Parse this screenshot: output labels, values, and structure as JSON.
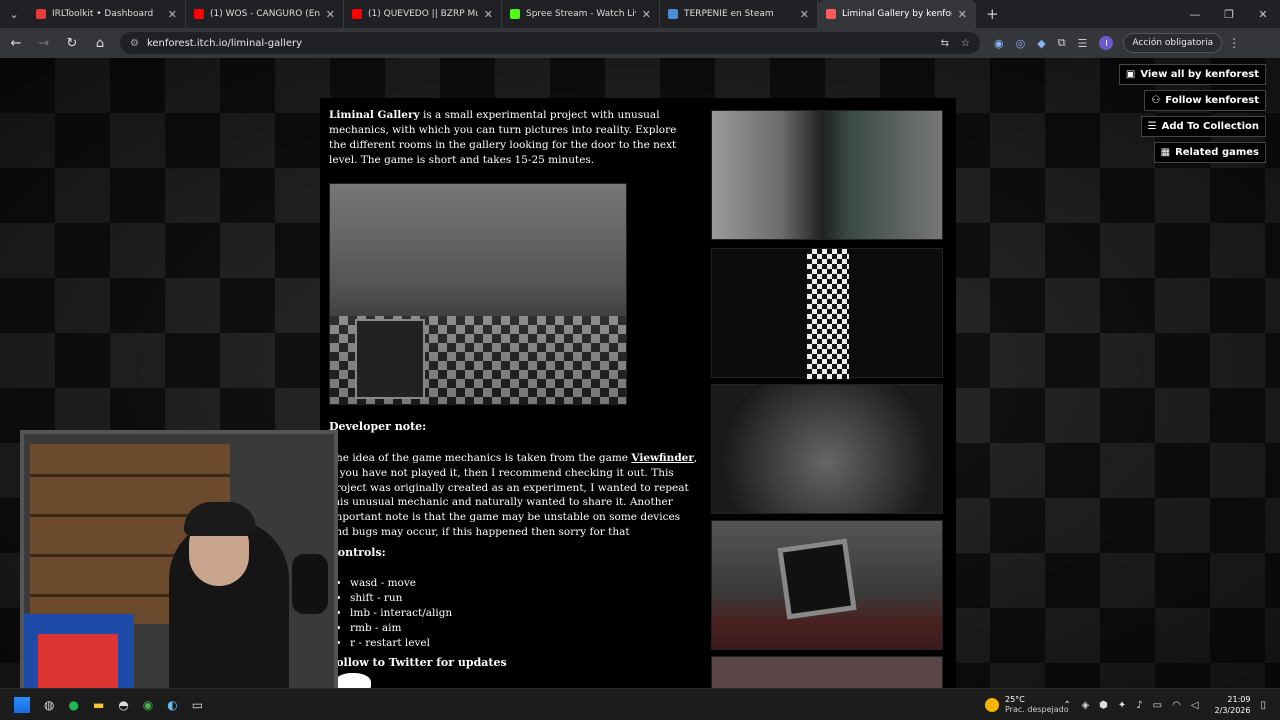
{
  "browser": {
    "tabs": [
      {
        "label": "IRLToolkit • Dashboard",
        "color": "#e83a3a"
      },
      {
        "label": "(1) WOS - CANGURO (En Vivo /",
        "color": "#ff0000"
      },
      {
        "label": "(1) QUEVEDO || BZRP Music Se",
        "color": "#ff0000"
      },
      {
        "label": "Spree Stream - Watch Live on",
        "color": "#53fc18"
      },
      {
        "label": "TERPENIE en Steam",
        "color": "#1b2838"
      },
      {
        "label": "Liminal Gallery by kenforest",
        "color": "#fa5c5c"
      }
    ],
    "url": "kenforest.itch.io/liminal-gallery",
    "profile_initial": "I",
    "action_label": "Acción obligatoria"
  },
  "sidebar_buttons": {
    "view_all": "View all by kenforest",
    "follow": "Follow kenforest",
    "add_collection": "Add To Collection",
    "related": "Related games"
  },
  "game": {
    "title": "Liminal Gallery",
    "intro": " is a small experimental project with unusual mechanics, with which you can turn pictures into reality. Explore the different rooms in the gallery looking for the door to the next level. The game is short and takes 15-25 minutes.",
    "dev_note_heading": "Developer note:",
    "dev_note_pre": "The idea of the game mechanics is taken from the game ",
    "dev_note_link": "Viewfinder",
    "dev_note_post": ", if you have not played it, then I recommend checking it out. This project was originally created as an experiment, I wanted to repeat this unusual mechanic and naturally wanted to share it. Another important note is that the game may be unstable on some devices and bugs may occur, if this happened then sorry for that",
    "controls_heading": "Controls:",
    "controls": [
      "wasd - move",
      "shift - run",
      "lmb - interact/align",
      "rmb - aim",
      "r - restart level"
    ],
    "twitter_heading": "Follow to Twitter for updates"
  },
  "taskbar": {
    "temperature": "25°C",
    "weather": "Prac. despejado",
    "time": "21:09",
    "date": "2/3/2026"
  }
}
